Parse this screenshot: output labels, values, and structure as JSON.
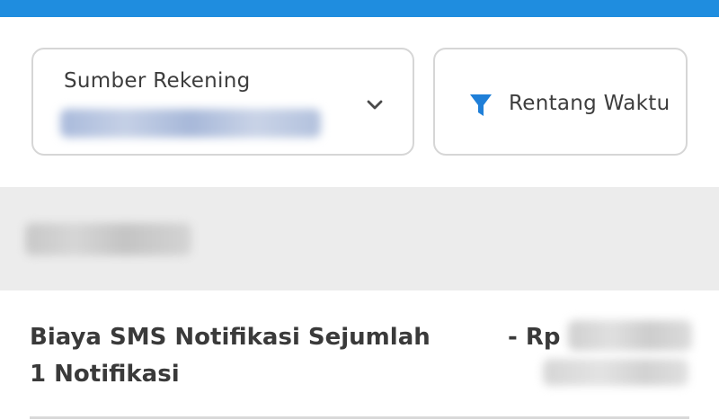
{
  "header": {
    "bar_color": "#1f8ddf"
  },
  "filters": {
    "account": {
      "label": "Sumber Rekening",
      "icon": "chevron-down-icon"
    },
    "date_range": {
      "label": "Rentang Waktu",
      "icon": "filter-icon",
      "icon_color": "#1f7fd8"
    }
  },
  "transactions": [
    {
      "description": "Biaya SMS Notifikasi Sejumlah\n1 Notifikasi",
      "amount_prefix": "- Rp"
    }
  ]
}
